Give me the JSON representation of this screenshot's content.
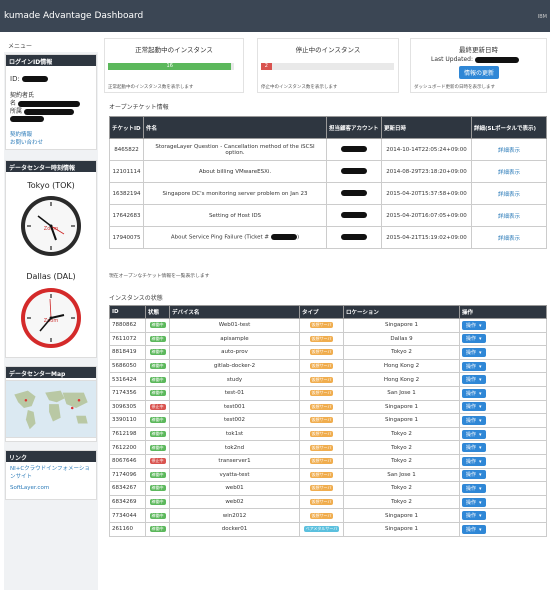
{
  "app": {
    "title": "kumade Advantage Dashboard",
    "user_short": "IBM"
  },
  "sidebar": {
    "menu_label": "メニュー",
    "login_panel": {
      "title": "ログインID情報",
      "id_label": "ID:",
      "contract_label": "契約者氏",
      "name_label": "名",
      "affiliation_label": "所属",
      "links": [
        "契約情報",
        "お問い合わせ"
      ]
    },
    "datacenter_panel": {
      "title": "データセンター時刻情報",
      "clocks": [
        {
          "label": "Tokyo (TOK)"
        },
        {
          "label": "Dallas (DAL)"
        }
      ]
    },
    "map_panel": {
      "title": "データセンターMap"
    },
    "links_panel": {
      "title": "リンク",
      "links": [
        "NI+Cクラウドインフォメーションサイト",
        "SoftLayer.com"
      ]
    }
  },
  "stats": {
    "running": {
      "title": "正常起動中のインスタンス",
      "value": "16",
      "fraction": 0.98,
      "color": "#5cb85c",
      "note": "正常起動中のインスタンス数を表示します"
    },
    "stopped": {
      "title": "停止中のインスタンス",
      "value": "2",
      "fraction": 0.08,
      "color": "#d9534f",
      "note": "停止中のインスタンス数を表示します"
    },
    "last_update": {
      "title": "最終更新日時",
      "prefix": "Last Updated:",
      "button": "情報の更新",
      "note": "ダッシュボード更新の日時を表示します"
    }
  },
  "tickets": {
    "section_title": "オープンチケット情報",
    "headers": [
      "チケットID",
      "件名",
      "担当顧客アカウント",
      "更新日時",
      "詳細(SLポータルで表示)"
    ],
    "rows": [
      {
        "id": "8465822",
        "subject": "StorageLayer Question - Cancellation method of the iSCSI option.",
        "updated": "2014-10-14T22:05:24+09:00",
        "detail": "詳細表示"
      },
      {
        "id": "12101114",
        "subject": "About billing VMwareESXi.",
        "updated": "2014-08-29T23:18:20+09:00",
        "detail": "詳細表示"
      },
      {
        "id": "16382194",
        "subject": "Singapore DC's monitoring server problem on Jan 23",
        "updated": "2015-04-20T15:37:58+09:00",
        "detail": "詳細表示"
      },
      {
        "id": "17642683",
        "subject": "Setting of Host IDS",
        "updated": "2015-04-20T16:07:05+09:00",
        "detail": "詳細表示"
      },
      {
        "id": "17940075",
        "subject": "About Service Ping Failure (Ticket #",
        "updated": "2015-04-21T15:19:02+09:00",
        "detail": "詳細表示"
      }
    ],
    "footnote": "現在オープンなチケット情報を一覧表示します"
  },
  "instances": {
    "section_title": "インスタンスの状態",
    "headers": [
      "ID",
      "状態",
      "デバイス名",
      "タイプ",
      "ロケーション",
      "操作"
    ],
    "status_labels": {
      "running": "稼働中",
      "stopped": "停止中"
    },
    "action_label": "操作",
    "rows": [
      {
        "id": "7880862",
        "status": "running",
        "name": "Web01-test",
        "type": "仮想サーバ",
        "location": "Singapore 1"
      },
      {
        "id": "7611072",
        "status": "running",
        "name": "apisample",
        "type": "仮想サーバ",
        "location": "Dallas 9"
      },
      {
        "id": "8818419",
        "status": "running",
        "name": "auto-prov",
        "type": "仮想サーバ",
        "location": "Tokyo 2"
      },
      {
        "id": "5686050",
        "status": "running",
        "name": "gitlab-docker-2",
        "type": "仮想サーバ",
        "location": "Hong Kong 2"
      },
      {
        "id": "5316424",
        "status": "running",
        "name": "study",
        "type": "仮想サーバ",
        "location": "Hong Kong 2"
      },
      {
        "id": "7174356",
        "status": "running",
        "name": "test-01",
        "type": "仮想サーバ",
        "location": "San Jose 1"
      },
      {
        "id": "3096305",
        "status": "stopped",
        "name": "test001",
        "type": "仮想サーバ",
        "location": "Singapore 1"
      },
      {
        "id": "3390110",
        "status": "running",
        "name": "test002",
        "type": "仮想サーバ",
        "location": "Singapore 1"
      },
      {
        "id": "7612198",
        "status": "running",
        "name": "tok1st",
        "type": "仮想サーバ",
        "location": "Tokyo 2"
      },
      {
        "id": "7612200",
        "status": "running",
        "name": "tok2nd",
        "type": "仮想サーバ",
        "location": "Tokyo 2"
      },
      {
        "id": "8067646",
        "status": "stopped",
        "name": "transerver1",
        "type": "仮想サーバ",
        "location": "Tokyo 2"
      },
      {
        "id": "7174096",
        "status": "running",
        "name": "vyatta-test",
        "type": "仮想サーバ",
        "location": "San Jose 1"
      },
      {
        "id": "6834267",
        "status": "running",
        "name": "web01",
        "type": "仮想サーバ",
        "location": "Tokyo 2"
      },
      {
        "id": "6834269",
        "status": "running",
        "name": "web02",
        "type": "仮想サーバ",
        "location": "Tokyo 2"
      },
      {
        "id": "7734044",
        "status": "running",
        "name": "win2012",
        "type": "仮想サーバ",
        "location": "Singapore 1"
      },
      {
        "id": "261160",
        "status": "running",
        "name": "docker01",
        "type": "ベアメタルサーバ",
        "location": "Singapore 1"
      }
    ]
  },
  "colors": {
    "header_bg": "#2e3640",
    "running": "#5cb85c",
    "stopped": "#d9534f",
    "type_virtual": "#f0ad4e",
    "type_baremetal": "#5bc0de",
    "button": "#2f87d6"
  }
}
